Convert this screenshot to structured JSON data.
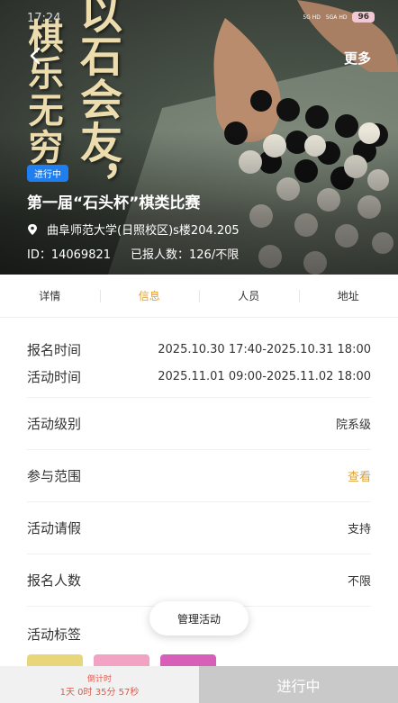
{
  "status_bar": {
    "time": "17:24",
    "network_1": "5G HD",
    "network_2": "5GA HD",
    "battery": "96"
  },
  "header": {
    "more_label": "更多"
  },
  "hero": {
    "calligraphy_line1": "棋乐无穷",
    "calligraphy_line2": "以石会友，",
    "badge": "进行中",
    "title": "第一届“石头杯”棋类比赛",
    "location": "曲阜师范大学(日照校区)s楼204.205",
    "id_text": "ID：14069821",
    "signup_count": "已报人数：126/不限"
  },
  "tabs": [
    {
      "label": "详情",
      "active": false
    },
    {
      "label": "信息",
      "active": true
    },
    {
      "label": "人员",
      "active": false
    },
    {
      "label": "地址",
      "active": false
    }
  ],
  "info": {
    "signup_time_label": "报名时间",
    "signup_time_value": "2025.10.30 17:40-2025.10.31 18:00",
    "activity_time_label": "活动时间",
    "activity_time_value": "2025.11.01 09:00-2025.11.02 18:00",
    "level_label": "活动级别",
    "level_value": "院系级",
    "scope_label": "参与范围",
    "scope_value": "查看",
    "leave_label": "活动请假",
    "leave_value": "支持",
    "count_label": "报名人数",
    "count_value": "不限",
    "tags_label": "活动标签"
  },
  "tag_colors": [
    "#e8d77a",
    "#f2a3c4",
    "#d75fb7"
  ],
  "manage_button": "管理活动",
  "bottom": {
    "countdown_title": "倒计时",
    "countdown_value": "1天 0时 35分 57秒",
    "status_button": "进行中"
  },
  "colors": {
    "accent": "#e0a12e",
    "badge_blue": "#1f7ef0",
    "countdown_red": "#e15a4a"
  }
}
